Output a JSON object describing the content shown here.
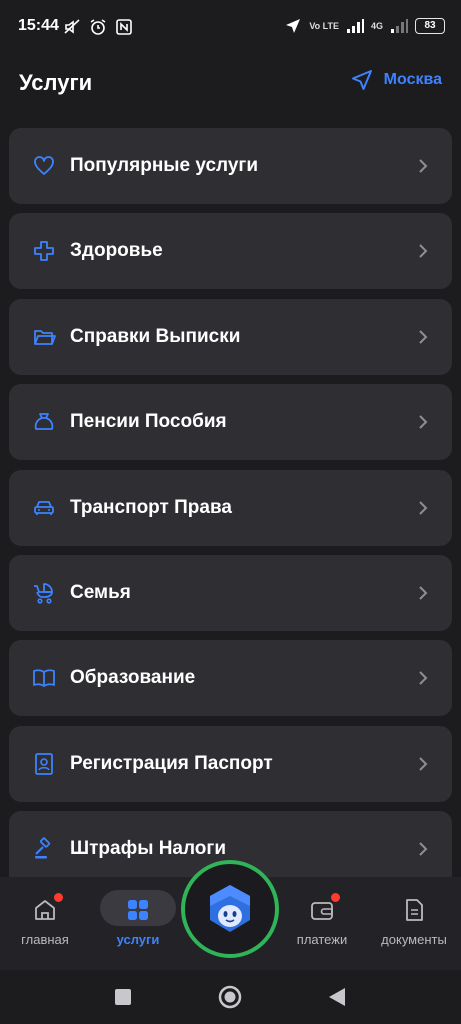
{
  "status_bar": {
    "time": "15:44",
    "battery": "83",
    "network": "4G",
    "volte": "Vo LTE"
  },
  "header": {
    "title": "Услуги",
    "location": "Москва"
  },
  "services": [
    {
      "label": "Популярные услуги",
      "icon": "heart-icon"
    },
    {
      "label": "Здоровье",
      "icon": "health-cross-icon"
    },
    {
      "label": "Справки Выписки",
      "icon": "folder-icon"
    },
    {
      "label": "Пенсии Пособия",
      "icon": "money-bag-icon"
    },
    {
      "label": "Транспорт Права",
      "icon": "car-icon"
    },
    {
      "label": "Семья",
      "icon": "stroller-icon"
    },
    {
      "label": "Образование",
      "icon": "book-icon"
    },
    {
      "label": "Регистрация Паспорт",
      "icon": "passport-icon"
    },
    {
      "label": "Штрафы Налоги",
      "icon": "gavel-icon"
    }
  ],
  "bottom_nav": {
    "home": "главная",
    "services": "услуги",
    "payments": "платежи",
    "documents": "документы",
    "active": "services"
  },
  "colors": {
    "accent": "#3d82ff",
    "background": "#1c1c1f",
    "card": "#2e2e33",
    "nav_bg": "#232327",
    "assistant_ring": "#2fb457",
    "badge": "#ff3b30"
  }
}
